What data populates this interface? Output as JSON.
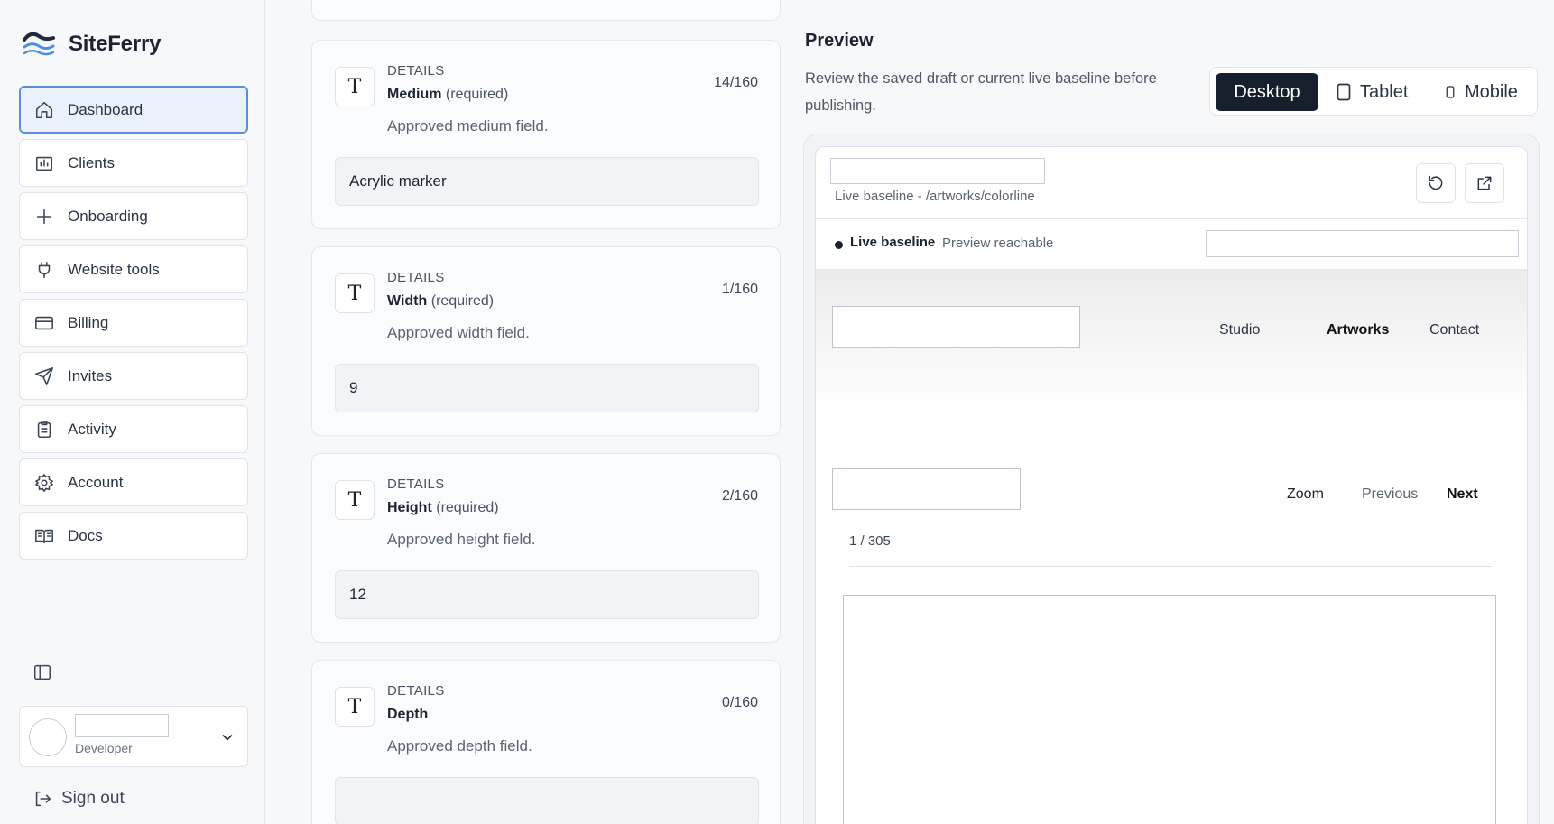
{
  "brand": {
    "name": "SiteFerry",
    "logo_icon": "wave-icon"
  },
  "sidebar": {
    "items": [
      {
        "label": "Dashboard",
        "icon": "home-icon",
        "active": true
      },
      {
        "label": "Clients",
        "icon": "chart-icon",
        "active": false
      },
      {
        "label": "Onboarding",
        "icon": "plus-icon",
        "active": false
      },
      {
        "label": "Website tools",
        "icon": "plug-icon",
        "active": false
      },
      {
        "label": "Billing",
        "icon": "card-icon",
        "active": false
      },
      {
        "label": "Invites",
        "icon": "send-icon",
        "active": false
      },
      {
        "label": "Activity",
        "icon": "clipboard-icon",
        "active": false
      },
      {
        "label": "Account",
        "icon": "gear-icon",
        "active": false
      },
      {
        "label": "Docs",
        "icon": "book-icon",
        "active": false
      }
    ],
    "user": {
      "role": "Developer"
    },
    "signout_label": "Sign out"
  },
  "fields": [
    {
      "kicker": "DETAILS",
      "label": "Medium",
      "required": "(required)",
      "count": "14/160",
      "description": "Approved medium field.",
      "value": "Acrylic marker"
    },
    {
      "kicker": "DETAILS",
      "label": "Width",
      "required": "(required)",
      "count": "1/160",
      "description": "Approved width field.",
      "value": "9"
    },
    {
      "kicker": "DETAILS",
      "label": "Height",
      "required": "(required)",
      "count": "2/160",
      "description": "Approved height field.",
      "value": "12"
    },
    {
      "kicker": "DETAILS",
      "label": "Depth",
      "required": "",
      "count": "0/160",
      "description": "Approved depth field.",
      "value": ""
    }
  ],
  "preview": {
    "title": "Preview",
    "description": "Review the saved draft or current live baseline before publishing.",
    "devices": {
      "desktop": "Desktop",
      "tablet": "Tablet",
      "mobile": "Mobile"
    },
    "path": "Live baseline - /artworks/colorline",
    "status_label": "Live baseline",
    "status_detail": "Preview reachable",
    "site": {
      "nav": [
        "Studio",
        "Artworks",
        "Contact"
      ],
      "zoom": "Zoom",
      "previous": "Previous",
      "next": "Next",
      "counter": "1 / 305"
    }
  }
}
